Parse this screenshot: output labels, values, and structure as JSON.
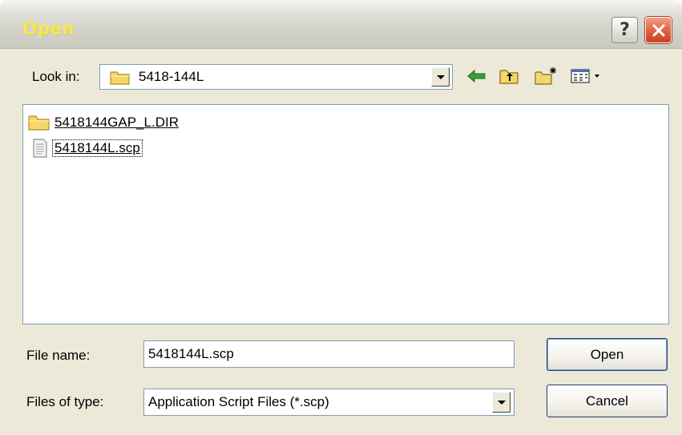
{
  "window": {
    "title": "Open"
  },
  "look_in": {
    "label": "Look in:",
    "value": "5418-144L"
  },
  "files": [
    {
      "name": "5418144GAP_L.DIR",
      "icon": "folder-icon",
      "selected": false
    },
    {
      "name": "5418144L.scp",
      "icon": "script-file-icon",
      "selected": true
    }
  ],
  "file_name": {
    "label": "File name:",
    "value": "5418144L.scp"
  },
  "file_type": {
    "label": "Files of type:",
    "value": "Application Script Files (*.scp)"
  },
  "buttons": {
    "open": "Open",
    "cancel": "Cancel"
  },
  "title_buttons": {
    "help": "?"
  },
  "colors": {
    "title_text": "#f5e94a",
    "close": "#d9532c",
    "frame": "#ece9d8",
    "field_border": "#7f9db9"
  }
}
